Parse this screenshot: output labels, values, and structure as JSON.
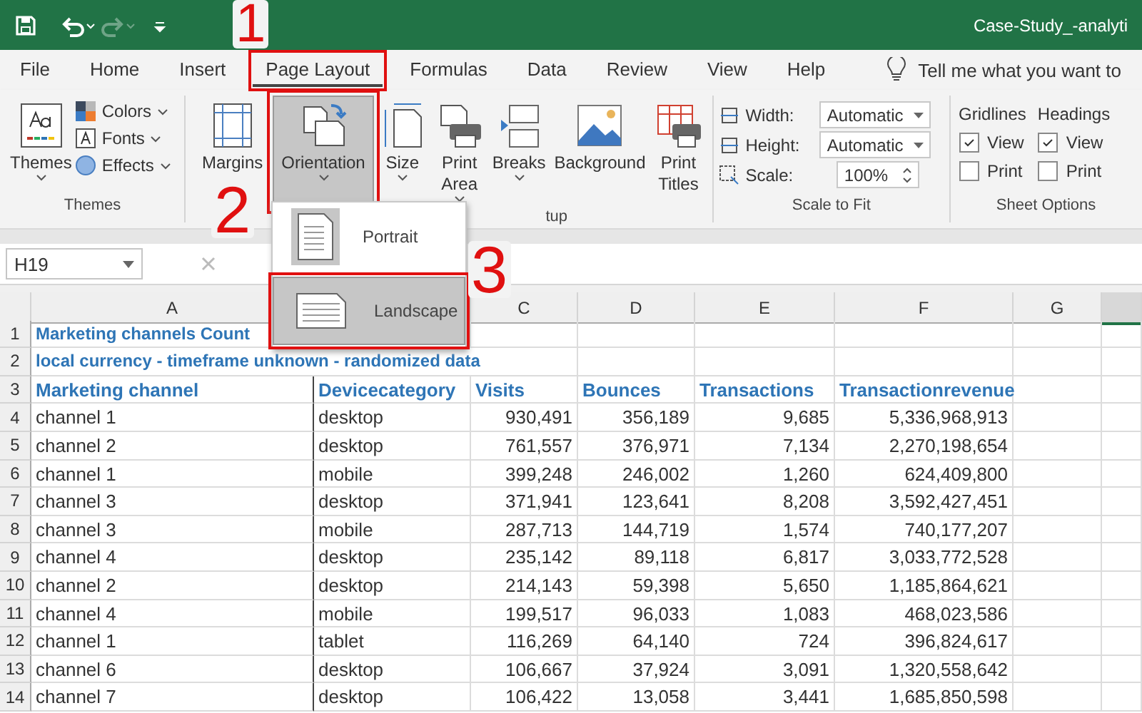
{
  "window": {
    "title": "Case-Study_-analyti",
    "redo_disabled": true
  },
  "tabs": [
    {
      "label": "File",
      "selected": false
    },
    {
      "label": "Home",
      "selected": false
    },
    {
      "label": "Insert",
      "selected": false
    },
    {
      "label": "Page Layout",
      "selected": true
    },
    {
      "label": "Formulas",
      "selected": false
    },
    {
      "label": "Data",
      "selected": false
    },
    {
      "label": "Review",
      "selected": false
    },
    {
      "label": "View",
      "selected": false
    },
    {
      "label": "Help",
      "selected": false
    }
  ],
  "tell_me": "Tell me what you want to",
  "ribbon": {
    "themes": {
      "label": "Themes",
      "button": "Themes",
      "items": [
        "Colors",
        "Fonts",
        "Effects"
      ]
    },
    "page_setup": {
      "label": "tup",
      "buttons": [
        {
          "label": "Margins",
          "selected": false,
          "caret": false
        },
        {
          "label": "Orientation",
          "selected": true,
          "caret": true
        },
        {
          "label": "Size",
          "selected": false,
          "caret": true
        },
        {
          "label": "Print Area",
          "selected": false,
          "caret": true
        },
        {
          "label": "Breaks",
          "selected": false,
          "caret": true
        },
        {
          "label": "Background",
          "selected": false,
          "caret": false
        },
        {
          "label": "Print Titles",
          "selected": false,
          "caret": false
        }
      ]
    },
    "scale_to_fit": {
      "label": "Scale to Fit",
      "rows": [
        {
          "label": "Width:",
          "value": "Automatic",
          "kind": "dropdown"
        },
        {
          "label": "Height:",
          "value": "Automatic",
          "kind": "dropdown"
        },
        {
          "label": "Scale:",
          "value": "100%",
          "kind": "spinner"
        }
      ]
    },
    "sheet_options": {
      "label": "Sheet Options",
      "columns": [
        {
          "title": "Gridlines",
          "options": [
            {
              "label": "View",
              "checked": true
            },
            {
              "label": "Print",
              "checked": false
            }
          ]
        },
        {
          "title": "Headings",
          "options": [
            {
              "label": "View",
              "checked": true
            },
            {
              "label": "Print",
              "checked": false
            }
          ]
        }
      ]
    }
  },
  "orientation_menu": [
    {
      "label": "Portrait",
      "selected": false,
      "current": true
    },
    {
      "label": "Landscape",
      "selected": true,
      "current": false
    }
  ],
  "annotations": [
    {
      "label": "1"
    },
    {
      "label": "2"
    },
    {
      "label": "3"
    }
  ],
  "formula_bar": {
    "name_box": "H19"
  },
  "sheet": {
    "columns": [
      {
        "label": "A"
      },
      {},
      {
        "label": "C"
      },
      {
        "label": "D"
      },
      {
        "label": "E"
      },
      {
        "label": "F"
      },
      {
        "label": "G"
      }
    ],
    "rows": [
      {
        "number": "1",
        "kind": "title",
        "cells": [
          "Marketing channels Count"
        ]
      },
      {
        "number": "2",
        "kind": "title",
        "cells": [
          "local currency - timeframe unknown - randomized data"
        ]
      },
      {
        "number": "3",
        "kind": "header",
        "cells": [
          "Marketing channel",
          "Devicecategory",
          "Visits",
          "Bounces",
          "Transactions",
          "Transactionrevenue"
        ]
      },
      {
        "number": "4",
        "kind": "data",
        "cells": [
          "channel 1",
          "desktop",
          "930,491",
          "356,189",
          "9,685",
          "5,336,968,913"
        ]
      },
      {
        "number": "5",
        "kind": "data",
        "cells": [
          "channel 2",
          "desktop",
          "761,557",
          "376,971",
          "7,134",
          "2,270,198,654"
        ]
      },
      {
        "number": "6",
        "kind": "data",
        "cells": [
          "channel 1",
          "mobile",
          "399,248",
          "246,002",
          "1,260",
          "624,409,800"
        ]
      },
      {
        "number": "7",
        "kind": "data",
        "cells": [
          "channel 3",
          "desktop",
          "371,941",
          "123,641",
          "8,208",
          "3,592,427,451"
        ]
      },
      {
        "number": "8",
        "kind": "data",
        "cells": [
          "channel 3",
          "mobile",
          "287,713",
          "144,719",
          "1,574",
          "740,177,207"
        ]
      },
      {
        "number": "9",
        "kind": "data",
        "cells": [
          "channel 4",
          "desktop",
          "235,142",
          "89,118",
          "6,817",
          "3,033,772,528"
        ]
      },
      {
        "number": "10",
        "kind": "data",
        "cells": [
          "channel 2",
          "desktop",
          "214,143",
          "59,398",
          "5,650",
          "1,185,864,621"
        ]
      },
      {
        "number": "11",
        "kind": "data",
        "cells": [
          "channel 4",
          "mobile",
          "199,517",
          "96,033",
          "1,083",
          "468,023,586"
        ]
      },
      {
        "number": "12",
        "kind": "data",
        "cells": [
          "channel 1",
          "tablet",
          "116,269",
          "64,140",
          "724",
          "396,824,617"
        ]
      },
      {
        "number": "13",
        "kind": "data",
        "cells": [
          "channel 6",
          "desktop",
          "106,667",
          "37,924",
          "3,091",
          "1,320,558,642"
        ]
      },
      {
        "number": "14",
        "kind": "data",
        "cells": [
          "channel 7",
          "desktop",
          "106,422",
          "13,058",
          "3,441",
          "1,685,850,598"
        ]
      }
    ]
  }
}
